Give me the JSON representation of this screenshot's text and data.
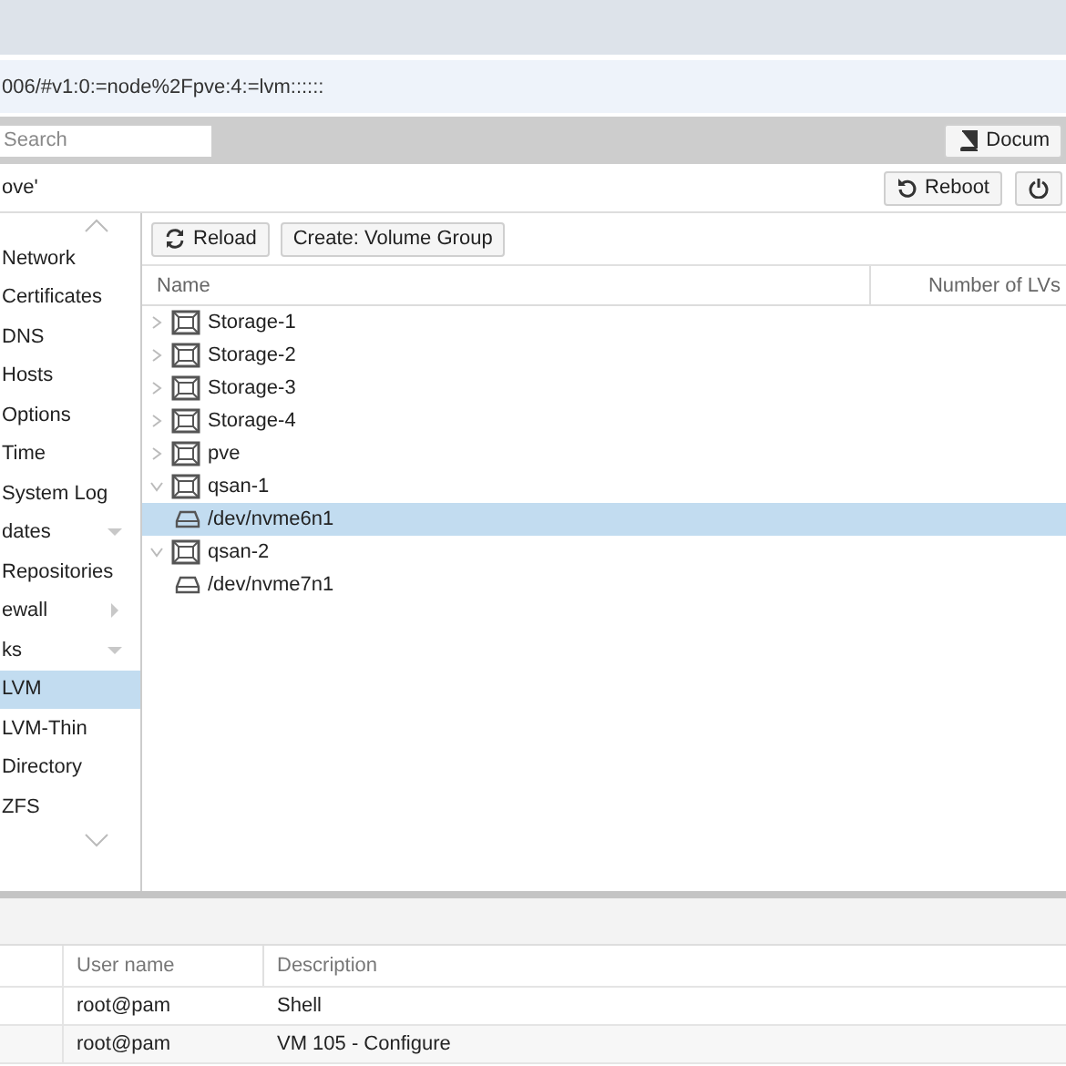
{
  "address_bar": {
    "url": "006/#v1:0:=node%2Fpve:4:=lvm::::::"
  },
  "toolbar": {
    "search": {
      "placeholder": "Search"
    },
    "documentation_button": "Docum"
  },
  "header": {
    "title": "ove'",
    "buttons": [
      {
        "kind": "reboot",
        "label": "Reboot"
      },
      {
        "kind": "power"
      }
    ]
  },
  "sidebar": {
    "items": [
      {
        "kind": "item",
        "label": "Network",
        "selected": false
      },
      {
        "kind": "item",
        "label": "Certificates",
        "selected": false
      },
      {
        "kind": "item",
        "label": "DNS",
        "selected": false
      },
      {
        "kind": "item",
        "label": "Hosts",
        "selected": false
      },
      {
        "kind": "item",
        "label": "Options",
        "selected": false
      },
      {
        "kind": "item",
        "label": "Time",
        "selected": false
      },
      {
        "kind": "item",
        "label": "System Log",
        "selected": false
      },
      {
        "kind": "group",
        "label": "dates",
        "selected": false,
        "expanded": true
      },
      {
        "kind": "item",
        "label": "Repositories",
        "selected": false
      },
      {
        "kind": "group",
        "label": "ewall",
        "selected": false,
        "expanded": false
      },
      {
        "kind": "group",
        "label": "ks",
        "selected": false,
        "expanded": true
      },
      {
        "kind": "item",
        "label": "LVM",
        "selected": true
      },
      {
        "kind": "item",
        "label": "LVM-Thin",
        "selected": false
      },
      {
        "kind": "item",
        "label": "Directory",
        "selected": false
      },
      {
        "kind": "item",
        "label": "ZFS",
        "selected": false
      }
    ]
  },
  "content": {
    "buttons": [
      {
        "kind": "reload",
        "label": "Reload"
      },
      {
        "kind": "plain",
        "label": "Create: Volume Group"
      }
    ],
    "table": {
      "columns": [
        "Name",
        "Number of LVs"
      ],
      "rows": [
        {
          "kind": "vg",
          "name": "Storage-1",
          "expanded": false,
          "selected": false
        },
        {
          "kind": "vg",
          "name": "Storage-2",
          "expanded": false,
          "selected": false
        },
        {
          "kind": "vg",
          "name": "Storage-3",
          "expanded": false,
          "selected": false
        },
        {
          "kind": "vg",
          "name": "Storage-4",
          "expanded": false,
          "selected": false
        },
        {
          "kind": "vg",
          "name": "pve",
          "expanded": false,
          "selected": false
        },
        {
          "kind": "vg",
          "name": "qsan-1",
          "expanded": true,
          "selected": false,
          "children": [
            {
              "kind": "disk",
              "name": "/dev/nvme6n1",
              "selected": true
            }
          ]
        },
        {
          "kind": "vg",
          "name": "qsan-2",
          "expanded": true,
          "selected": false,
          "children": [
            {
              "kind": "disk",
              "name": "/dev/nvme7n1",
              "selected": false
            }
          ]
        }
      ]
    }
  },
  "tasks": {
    "columns": [
      "User name",
      "Description"
    ],
    "rows": [
      {
        "user": "root@pam",
        "description": "Shell"
      },
      {
        "user": "root@pam",
        "description": "VM 105 - Configure"
      }
    ]
  }
}
